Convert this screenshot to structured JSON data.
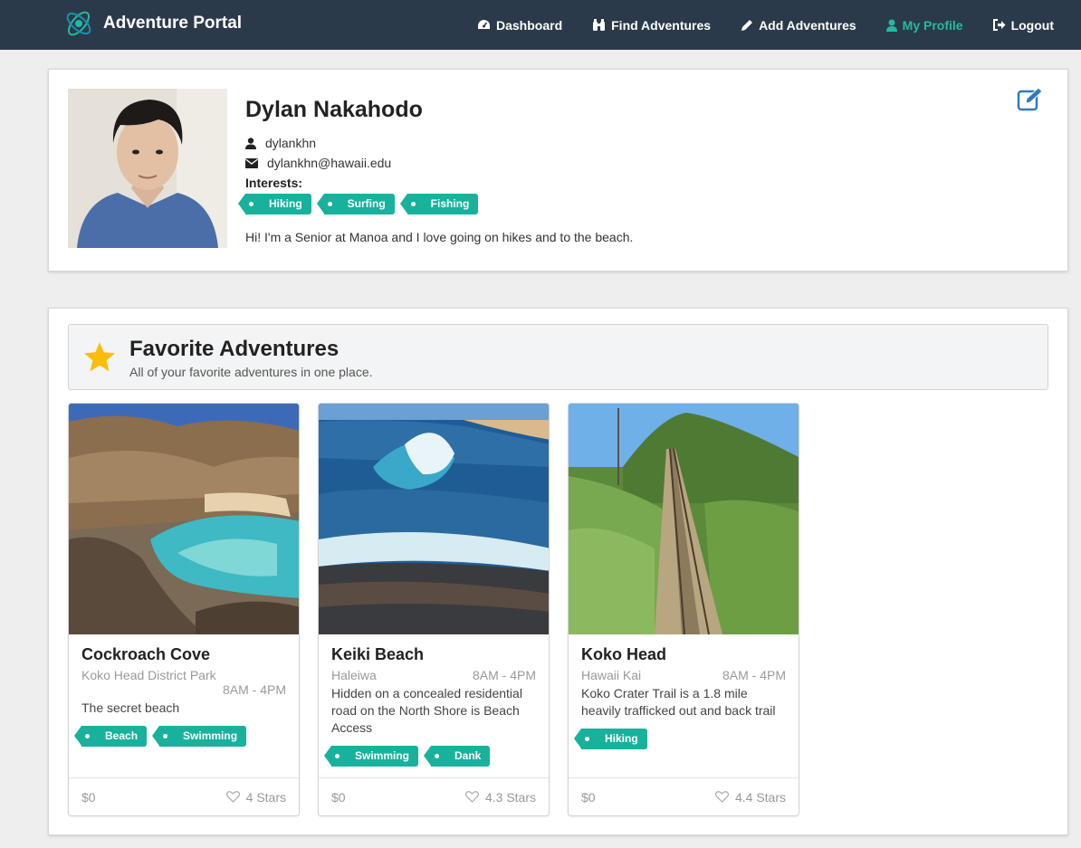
{
  "nav": {
    "brand": "Adventure Portal",
    "items": [
      {
        "label": "Dashboard",
        "icon": "dashboard-icon"
      },
      {
        "label": "Find Adventures",
        "icon": "binoculars-icon"
      },
      {
        "label": "Add Adventures",
        "icon": "pencil-icon"
      },
      {
        "label": "My Profile",
        "icon": "user-icon",
        "active": true
      },
      {
        "label": "Logout",
        "icon": "sign-out-icon"
      }
    ]
  },
  "profile": {
    "name": "Dylan Nakahodo",
    "username": "dylankhn",
    "email": "dylankhn@hawaii.edu",
    "interests_label": "Interests:",
    "interests": [
      "Hiking",
      "Surfing",
      "Fishing"
    ],
    "bio": "Hi! I'm a Senior at Manoa and I love going on hikes and to the beach."
  },
  "favorites": {
    "title": "Favorite Adventures",
    "subtitle": "All of your favorite adventures in one place.",
    "cards": [
      {
        "title": "Cockroach Cove",
        "location": "Koko Head District Park",
        "hours": "8AM - 4PM",
        "description": "The secret beach",
        "tags": [
          "Beach",
          "Swimming"
        ],
        "price": "$0",
        "rating": "4 Stars"
      },
      {
        "title": "Keiki Beach",
        "location": "Haleiwa",
        "hours": "8AM - 4PM",
        "description": "Hidden on a concealed residential road on the North Shore is Beach Access",
        "tags": [
          "Swimming",
          "Dank"
        ],
        "price": "$0",
        "rating": "4.3 Stars"
      },
      {
        "title": "Koko Head",
        "location": "Hawaii Kai",
        "hours": "8AM - 4PM",
        "description": "Koko Crater Trail is a 1.8 mile heavily trafficked out and back trail",
        "tags": [
          "Hiking"
        ],
        "price": "$0",
        "rating": "4.4 Stars"
      }
    ]
  },
  "colors": {
    "nav_bg": "#2b3a4a",
    "accent": "#26b8a4",
    "tag": "#18b29c",
    "star": "#fbbd08",
    "edit_icon": "#2f7bbf"
  }
}
